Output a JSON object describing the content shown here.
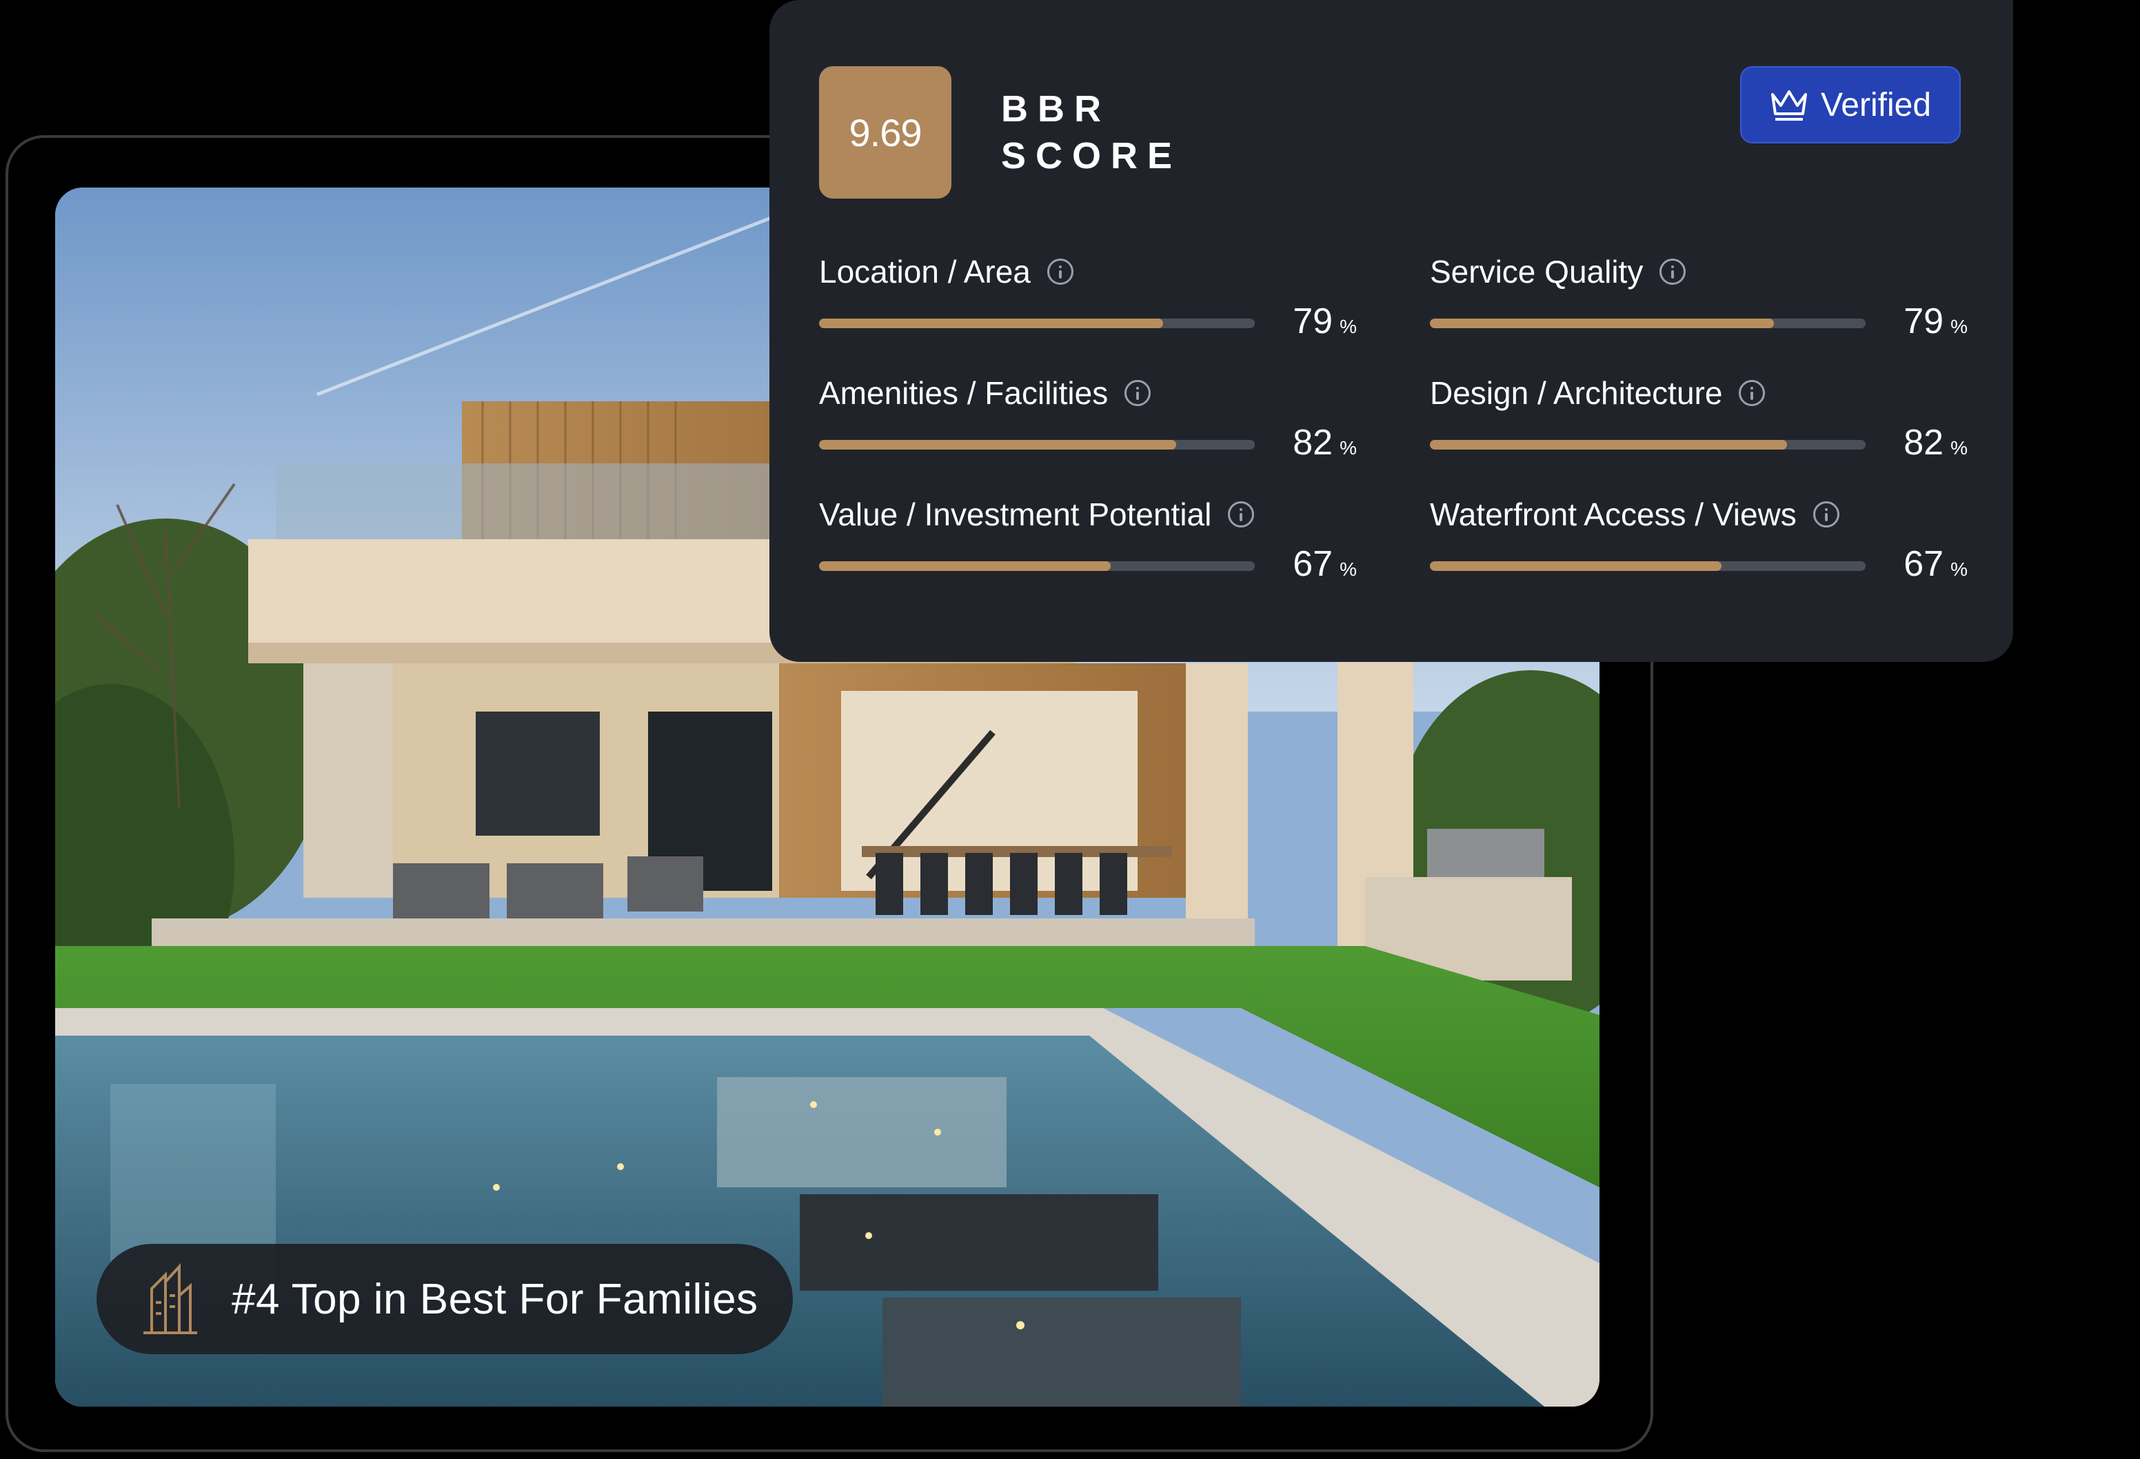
{
  "score_panel": {
    "score": "9.69",
    "title_line1": "BBR",
    "title_line2": "SCORE",
    "verified_label": "Verified",
    "metrics": [
      {
        "label": "Location / Area",
        "value": "79",
        "unit": "%",
        "fraction": 0.79
      },
      {
        "label": "Service Quality",
        "value": "79",
        "unit": "%",
        "fraction": 0.79
      },
      {
        "label": "Amenities / Facilities",
        "value": "82",
        "unit": "%",
        "fraction": 0.82
      },
      {
        "label": "Design / Architecture",
        "value": "82",
        "unit": "%",
        "fraction": 0.82
      },
      {
        "label": "Value / Investment Potential",
        "value": "67",
        "unit": "%",
        "fraction": 0.67
      },
      {
        "label": "Waterfront Access / Views",
        "value": "67",
        "unit": "%",
        "fraction": 0.67
      }
    ]
  },
  "rank_badge": {
    "text": "#4 Top in Best For Families",
    "icon": "building-logo-icon"
  },
  "colors": {
    "panel_bg": "#20242a",
    "accent_gold": "#b0885c",
    "verified_blue": "#2442b4",
    "bar_track": "#4a4f57"
  }
}
